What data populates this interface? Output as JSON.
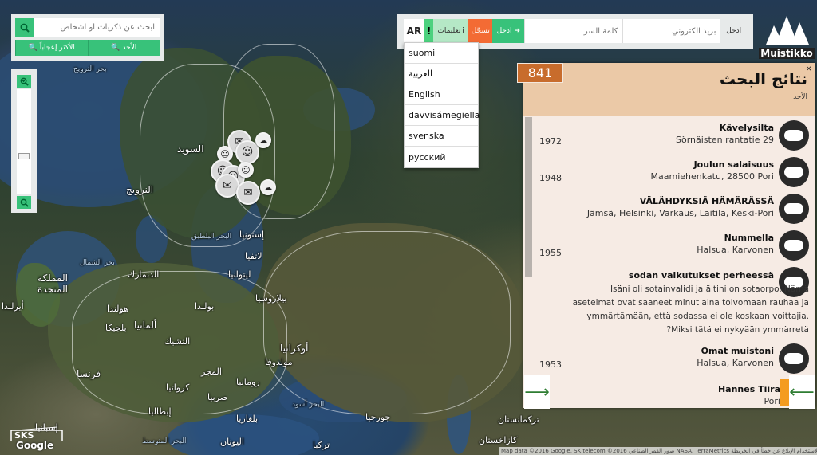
{
  "search": {
    "placeholder": "ابحث عن ذكريات أو أشخاص",
    "tab_popular": "الأكثر إعجاباً",
    "tab_newest": "الأحد"
  },
  "topbar": {
    "lang_code": "AR",
    "excl": "!",
    "help_label": "تعليمات",
    "register_label": "تسجّل",
    "login_label": "ادخل",
    "password_placeholder": "كلمة السر",
    "email_placeholder": "بريد الكتروني",
    "login_prompt": "ادخل"
  },
  "logo": {
    "text": "Muistikko"
  },
  "languages": [
    "suomi",
    "العربية",
    "English",
    "davvisámegiella",
    "svenska",
    "русский"
  ],
  "results": {
    "count": "841",
    "title": "نتائج البحث",
    "subtitle": "الأحد",
    "close": "×",
    "items": [
      {
        "title": "Kävelysilta",
        "subtitle": "Sörnäisten rantatie 29",
        "year": "1972"
      },
      {
        "title": "Joulun salaisuus",
        "subtitle": "Maamiehenkatu, 28500 Pori",
        "year": "1948"
      },
      {
        "title": "VÄLÄHDYKSIÄ HÄMÄRÄSSÄ",
        "subtitle": "Jämsä, Helsinki, Varkaus, Laitila, Keski-Pori",
        "year": ""
      },
      {
        "title": "Nummella",
        "subtitle": "Halsua, Karvonen",
        "year": "1955"
      },
      {
        "title": "sodan vaikutukset perheessä",
        "desc": [
          "Isäni oli sotainvalidi ja äitini on sotaorpo. Nämä",
          "asetelmat ovat saaneet minut aina toivomaan rauhaa ja",
          "ymmärtämään, että sodassa ei ole koskaan voittajia.",
          "?Miksi tätä ei nykyään ymmärretä"
        ],
        "year": ""
      },
      {
        "title": "Omat muistoni",
        "subtitle": "Halsua, Karvonen",
        "year": "1953"
      },
      {
        "title": "Hannes Tiira",
        "subtitle": "Pori",
        "year": ""
      }
    ]
  },
  "map": {
    "labels": {
      "sweden": "السويد",
      "norway": "النرويج",
      "estonia": "إستونيا",
      "latvia": "لاتفيا",
      "lithuania": "ليتوانيا",
      "belarus": "بيلاروسيا",
      "poland": "بولندا",
      "germany": "ألمانيا",
      "uk": "المملكة المتحدة",
      "ireland": "أيرلندا",
      "france": "فرنسا",
      "italy": "إيطاليا",
      "spain": "إسبانيا",
      "ukraine": "أوكرانيا",
      "romania": "رومانيا",
      "kazakhstan": "كازاخستان",
      "turkey": "تركيا",
      "greece": "اليونان",
      "georgia": "جورجيا",
      "denmark": "الدنمارك",
      "netherlands": "هولندا",
      "moldova": "مولدوفا",
      "czech": "التشيك",
      "hungary": "المجر",
      "bulgaria": "بلغاريا",
      "serbia": "صربيا",
      "croatia": "كرواتيا",
      "belgium": "بلجيكا",
      "turkmenistan": "تركمانستان",
      "sea_norway": "بحر النرويج",
      "sea_north": "بحر الشمال",
      "sea_baltic": "البحر البلطيق",
      "sea_black": "البحر أسود",
      "mediterranean": "البحر المتوسط"
    },
    "sks": "SKS",
    "google": "Google",
    "attribution": "Map data ©2016 Google, SK telecom ©2016 صور القمر الصناعي NASA, TerraMetrics شروط الاستخدام الإبلاغ عن خطأ في الخريطة"
  }
}
